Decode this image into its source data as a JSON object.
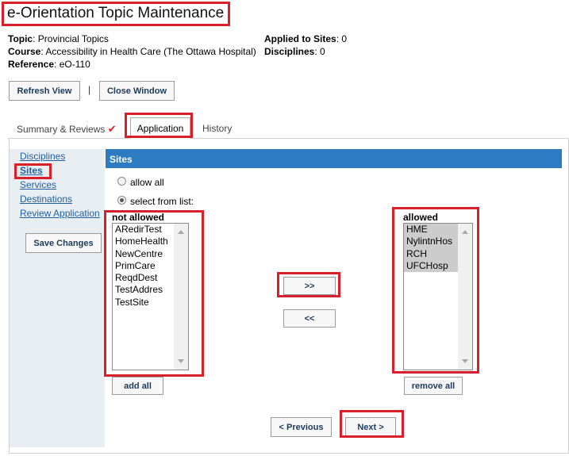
{
  "header": {
    "title": "e-Orientation Topic Maintenance",
    "topic_label": "Topic",
    "topic_value": "Provincial Topics",
    "course_label": "Course",
    "course_value": "Accessibility in Health Care (The Ottawa Hospital)",
    "reference_label": "Reference",
    "reference_value": "eO-110",
    "applied_label": "Applied to Sites",
    "applied_value": "0",
    "disciplines_label": "Disciplines",
    "disciplines_value": "0"
  },
  "toolbar": {
    "refresh_label": "Refresh View",
    "separator": "|",
    "close_label": "Close Window"
  },
  "tabs": [
    {
      "label": "Summary & Reviews",
      "check": "✔"
    },
    {
      "label": "Application"
    },
    {
      "label": "History"
    }
  ],
  "sidebar": {
    "items": [
      {
        "label": "Disciplines"
      },
      {
        "label": "Sites"
      },
      {
        "label": "Services"
      },
      {
        "label": "Destinations"
      },
      {
        "label": "Review Application"
      }
    ],
    "save_label": "Save Changes"
  },
  "sites": {
    "header": "Sites",
    "allow_all_label": "allow all",
    "select_label": "select from list:",
    "selected_option": "select from list:",
    "not_allowed_title": "not allowed",
    "not_allowed_items": [
      "ARedirTest",
      "HomeHealth",
      "NewCentre",
      "PrimCare",
      "ReqdDest",
      "TestAddres",
      "TestSite"
    ],
    "allowed_title": "allowed",
    "allowed_items": [
      "HME",
      "NylintnHos",
      "RCH",
      "UFCHosp"
    ],
    "move_right_label": ">>",
    "move_left_label": "<<",
    "add_all_label": "add all",
    "remove_all_label": "remove all"
  },
  "footer": {
    "previous_label": "< Previous",
    "next_label": "Next >"
  },
  "colors": {
    "accent": "#2d7bc0",
    "highlight_box": "#d9202a",
    "sidebar_bg": "#e9eef2",
    "link": "#1f5f9f"
  }
}
